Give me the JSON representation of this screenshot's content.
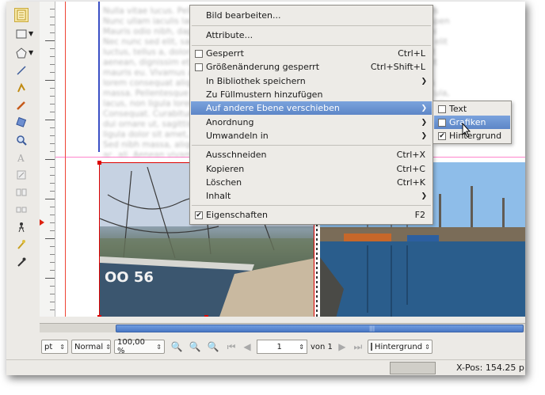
{
  "text_frame_lines": [
    "Nulla vitae lucus. Pellentesque as aliqua tempor. Proin a ultrices elite leo. Mauris",
    "Nunc ullam iaculis laoreet faucibus quis. Etiam, eget. Integer ac bibendum. Suspen",
    "Mauris odio nibh, dapibus id lacinia in, ullamcorper faucibus, sagittis. Integer mi",
    "Nec nunc sed elit, sagittis mauris, vel mauris interdum a, Nam et suscipit velit, elit",
    "luctus, tellus a, dolor. Sed eget ornare, viverra sed, lobortis. Sed nunc sed, et et",
    "aenean, dignissim et, elit. Donec elit vitae ut, sagittis faucibus massa purus, elit",
    "mauris eu. Vivamus auctor, sagittis non ligula pretium, ipsum. Integer tortor",
    "lorem consequat aliq. Ut sagittis fringilla. Phasellus cursus, sagittis, quis mauris ",
    "massa. Pellentesque sed lorem ultrices. Vestibulum consequat rutrum vel vehicula,",
    "lacus, non ligula lorem sed, turpis, sagittis interdum. Cras a arcu, massa ut mauris",
    "Consequat. Curabitur bibendum non eu dolor, elementum massa, non elit, sit amet,",
    "dui ornare ut, sagittis non, eleifend massa. Sed dapibus, sagittis accumsan.",
    "ligula dolor sit amet, turpis sagittis. Cras a mattis, lorem ipsum dolor sit.",
    "Sed nibh massa, aliquam feugiat et. Mauris, lorem, quis mauris, sit egestas.",
    "ac, ali. Aenean vivamus ut tempus nec lorem, sit amet egestas diam."
  ],
  "photo_text": "OO 56",
  "context_menu": {
    "items": [
      {
        "label": "Bild bearbeiten...",
        "shortcut": "",
        "submenu": false,
        "checkbox": null
      },
      {
        "label": "Attribute...",
        "shortcut": "",
        "submenu": false,
        "checkbox": null
      },
      {
        "label": "Gesperrt",
        "shortcut": "Ctrl+L",
        "submenu": false,
        "checkbox": "off"
      },
      {
        "label": "Größenänderung gesperrt",
        "shortcut": "Ctrl+Shift+L",
        "submenu": false,
        "checkbox": "off"
      },
      {
        "label": "In Bibliothek speichern",
        "shortcut": "",
        "submenu": true,
        "checkbox": null
      },
      {
        "label": "Zu Füllmustern hinzufügen",
        "shortcut": "",
        "submenu": false,
        "checkbox": null
      },
      {
        "label": "Auf andere Ebene verschieben",
        "shortcut": "",
        "submenu": true,
        "checkbox": null
      },
      {
        "label": "Anordnung",
        "shortcut": "",
        "submenu": true,
        "checkbox": null
      },
      {
        "label": "Umwandeln in",
        "shortcut": "",
        "submenu": true,
        "checkbox": null
      },
      {
        "label": "Ausschneiden",
        "shortcut": "Ctrl+X",
        "submenu": false,
        "checkbox": null
      },
      {
        "label": "Kopieren",
        "shortcut": "Ctrl+C",
        "submenu": false,
        "checkbox": null
      },
      {
        "label": "Löschen",
        "shortcut": "Ctrl+K",
        "submenu": false,
        "checkbox": null
      },
      {
        "label": "Inhalt",
        "shortcut": "",
        "submenu": true,
        "checkbox": null
      },
      {
        "label": "Eigenschaften",
        "shortcut": "F2",
        "submenu": false,
        "checkbox": "on"
      }
    ],
    "highlighted": "Auf andere Ebene verschieben"
  },
  "layer_submenu": {
    "items": [
      {
        "label": "Text",
        "checked": false
      },
      {
        "label": "Grafiken",
        "checked": false
      },
      {
        "label": "Hintergrund",
        "checked": true
      }
    ],
    "highlighted": "Grafiken"
  },
  "bottom_toolbar": {
    "unit": "pt",
    "view_mode": "Normal",
    "zoom": "100,00 %",
    "page": "1",
    "page_of": "von 1",
    "layer": "Hintergrund"
  },
  "status_bar": {
    "xpos_label": "X-Pos:",
    "xpos_value": "154.25 p"
  },
  "colors": {
    "accent": "#5d86c7",
    "guide_red": "#dd1111",
    "scroll_thumb": "#4a78c4"
  }
}
